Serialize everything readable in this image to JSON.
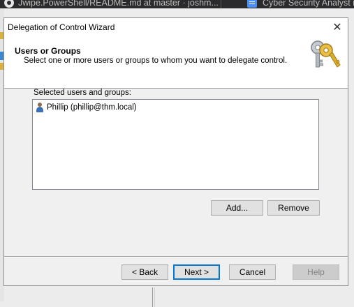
{
  "browser": {
    "tabs": [
      {
        "label": "Jwipe.PowerShell/README.md at master · joshm...",
        "icon": "github-icon"
      },
      {
        "label": "Cyber Security Analyst r",
        "icon": "document-icon"
      }
    ]
  },
  "dialog": {
    "title": "Delegation of Control Wizard",
    "close_glyph": "✕",
    "header": {
      "title": "Users or Groups",
      "subtitle": "Select one or more users or groups to whom you want to delegate control.",
      "icon": "keys-icon"
    },
    "list": {
      "label": "Selected users and groups:",
      "items": [
        {
          "text": "Phillip (phillip@thm.local)",
          "icon": "user-icon"
        }
      ]
    },
    "buttons": {
      "add": "Add...",
      "remove": "Remove",
      "back": "< Back",
      "next": "Next >",
      "cancel": "Cancel",
      "help": "Help"
    }
  },
  "colors": {
    "dialog_bg": "#f0f0f0",
    "accent": "#0078d7",
    "disabled_text": "#838383"
  }
}
